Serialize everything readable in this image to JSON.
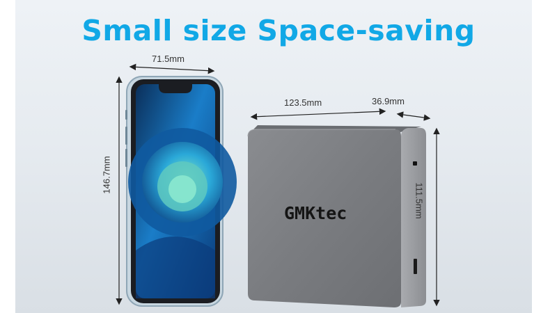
{
  "headline": "Small size Space-saving",
  "phone": {
    "width": "71.5mm",
    "height": "146.7mm"
  },
  "minipc": {
    "brand": "GMKtec",
    "length": "123.5mm",
    "depth": "36.9mm",
    "height": "111.5mm"
  },
  "colors": {
    "headline": "#11a8e6",
    "device_body": "#7d7f83",
    "phone_frame": "#9fb6c6"
  }
}
